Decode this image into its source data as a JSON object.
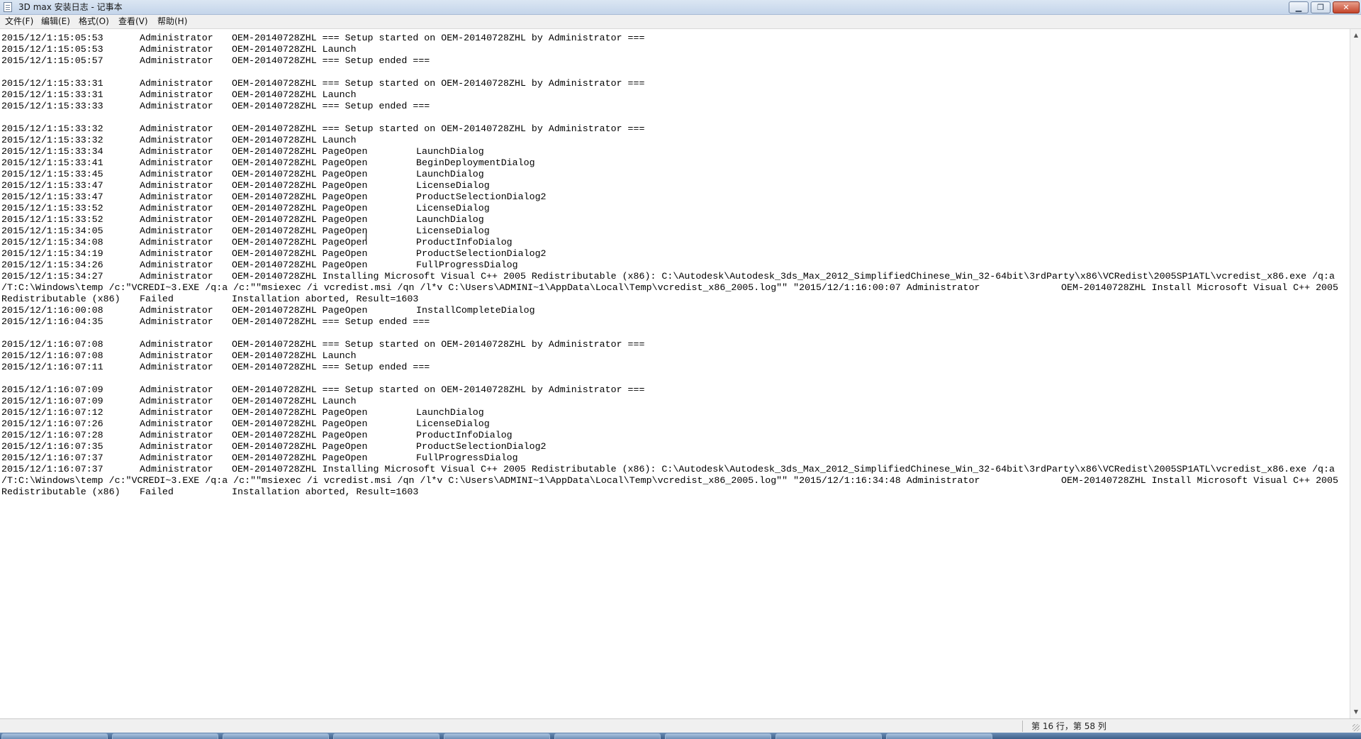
{
  "window": {
    "title": "3D max 安装日志 - 记事本",
    "icon": "notepad-icon",
    "controls": {
      "minimize": "▁",
      "maximize": "❐",
      "close": "✕"
    }
  },
  "menu": {
    "items": [
      "文件(F)",
      "编辑(E)",
      "格式(O)",
      "查看(V)",
      "帮助(H)"
    ]
  },
  "document": {
    "lines": [
      "2015/12/1:15:05:53\tAdministrator\tOEM-20140728ZHL === Setup started on OEM-20140728ZHL by Administrator ===",
      "2015/12/1:15:05:53\tAdministrator\tOEM-20140728ZHL Launch",
      "2015/12/1:15:05:57\tAdministrator\tOEM-20140728ZHL === Setup ended ===",
      "",
      "2015/12/1:15:33:31\tAdministrator\tOEM-20140728ZHL === Setup started on OEM-20140728ZHL by Administrator ===",
      "2015/12/1:15:33:31\tAdministrator\tOEM-20140728ZHL Launch",
      "2015/12/1:15:33:33\tAdministrator\tOEM-20140728ZHL === Setup ended ===",
      "",
      "2015/12/1:15:33:32\tAdministrator\tOEM-20140728ZHL === Setup started on OEM-20140728ZHL by Administrator ===",
      "2015/12/1:15:33:32\tAdministrator\tOEM-20140728ZHL Launch",
      "2015/12/1:15:33:34\tAdministrator\tOEM-20140728ZHL PageOpen\tLaunchDialog",
      "2015/12/1:15:33:41\tAdministrator\tOEM-20140728ZHL PageOpen\tBeginDeploymentDialog",
      "2015/12/1:15:33:45\tAdministrator\tOEM-20140728ZHL PageOpen\tLaunchDialog",
      "2015/12/1:15:33:47\tAdministrator\tOEM-20140728ZHL PageOpen\tLicenseDialog",
      "2015/12/1:15:33:47\tAdministrator\tOEM-20140728ZHL PageOpen\tProductSelectionDialog2",
      "2015/12/1:15:33:52\tAdministrator\tOEM-20140728ZHL PageOpen\tLicenseDialog",
      "2015/12/1:15:33:52\tAdministrator\tOEM-20140728ZHL PageOpen\tLaunchDialog",
      "2015/12/1:15:34:05\tAdministrator\tOEM-20140728ZHL PageOpen\tLicenseDialog",
      "2015/12/1:15:34:08\tAdministrator\tOEM-20140728ZHL PageOpen\tProductInfoDialog",
      "2015/12/1:15:34:19\tAdministrator\tOEM-20140728ZHL PageOpen\tProductSelectionDialog2",
      "2015/12/1:15:34:26\tAdministrator\tOEM-20140728ZHL PageOpen\tFullProgressDialog",
      "2015/12/1:15:34:27\tAdministrator\tOEM-20140728ZHL Installing Microsoft Visual C++ 2005 Redistributable (x86): C:\\Autodesk\\Autodesk_3ds_Max_2012_SimplifiedChinese_Win_32-64bit\\3rdParty\\x86\\VCRedist\\2005SP1ATL\\vcredist_x86.exe /q:a",
      "/T:C:\\Windows\\temp /c:\"VCREDI~3.EXE /q:a /c:\"\"msiexec /i vcredist.msi /qn /l*v C:\\Users\\ADMINI~1\\AppData\\Local\\Temp\\vcredist_x86_2005.log\"\" \"2015/12/1:16:00:07 Administrator\tOEM-20140728ZHL Install Microsoft Visual C++ 2005",
      "Redistributable (x86)\tFailed\tInstallation aborted, Result=1603",
      "2015/12/1:16:00:08\tAdministrator\tOEM-20140728ZHL PageOpen\tInstallCompleteDialog",
      "2015/12/1:16:04:35\tAdministrator\tOEM-20140728ZHL === Setup ended ===",
      "",
      "2015/12/1:16:07:08\tAdministrator\tOEM-20140728ZHL === Setup started on OEM-20140728ZHL by Administrator ===",
      "2015/12/1:16:07:08\tAdministrator\tOEM-20140728ZHL Launch",
      "2015/12/1:16:07:11\tAdministrator\tOEM-20140728ZHL === Setup ended ===",
      "",
      "2015/12/1:16:07:09\tAdministrator\tOEM-20140728ZHL === Setup started on OEM-20140728ZHL by Administrator ===",
      "2015/12/1:16:07:09\tAdministrator\tOEM-20140728ZHL Launch",
      "2015/12/1:16:07:12\tAdministrator\tOEM-20140728ZHL PageOpen\tLaunchDialog",
      "2015/12/1:16:07:26\tAdministrator\tOEM-20140728ZHL PageOpen\tLicenseDialog",
      "2015/12/1:16:07:28\tAdministrator\tOEM-20140728ZHL PageOpen\tProductInfoDialog",
      "2015/12/1:16:07:35\tAdministrator\tOEM-20140728ZHL PageOpen\tProductSelectionDialog2",
      "2015/12/1:16:07:37\tAdministrator\tOEM-20140728ZHL PageOpen\tFullProgressDialog",
      "2015/12/1:16:07:37\tAdministrator\tOEM-20140728ZHL Installing Microsoft Visual C++ 2005 Redistributable (x86): C:\\Autodesk\\Autodesk_3ds_Max_2012_SimplifiedChinese_Win_32-64bit\\3rdParty\\x86\\VCRedist\\2005SP1ATL\\vcredist_x86.exe /q:a",
      "/T:C:\\Windows\\temp /c:\"VCREDI~3.EXE /q:a /c:\"\"msiexec /i vcredist.msi /qn /l*v C:\\Users\\ADMINI~1\\AppData\\Local\\Temp\\vcredist_x86_2005.log\"\" \"2015/12/1:16:34:48 Administrator\tOEM-20140728ZHL Install Microsoft Visual C++ 2005",
      "Redistributable (x86)\tFailed\tInstallation aborted, Result=1603"
    ]
  },
  "status": {
    "cursor_position": "第 16 行，第 58 列"
  },
  "scrollbar": {
    "up_arrow": "▲",
    "down_arrow": "▼"
  },
  "taskbar": {
    "buttons": 9
  }
}
